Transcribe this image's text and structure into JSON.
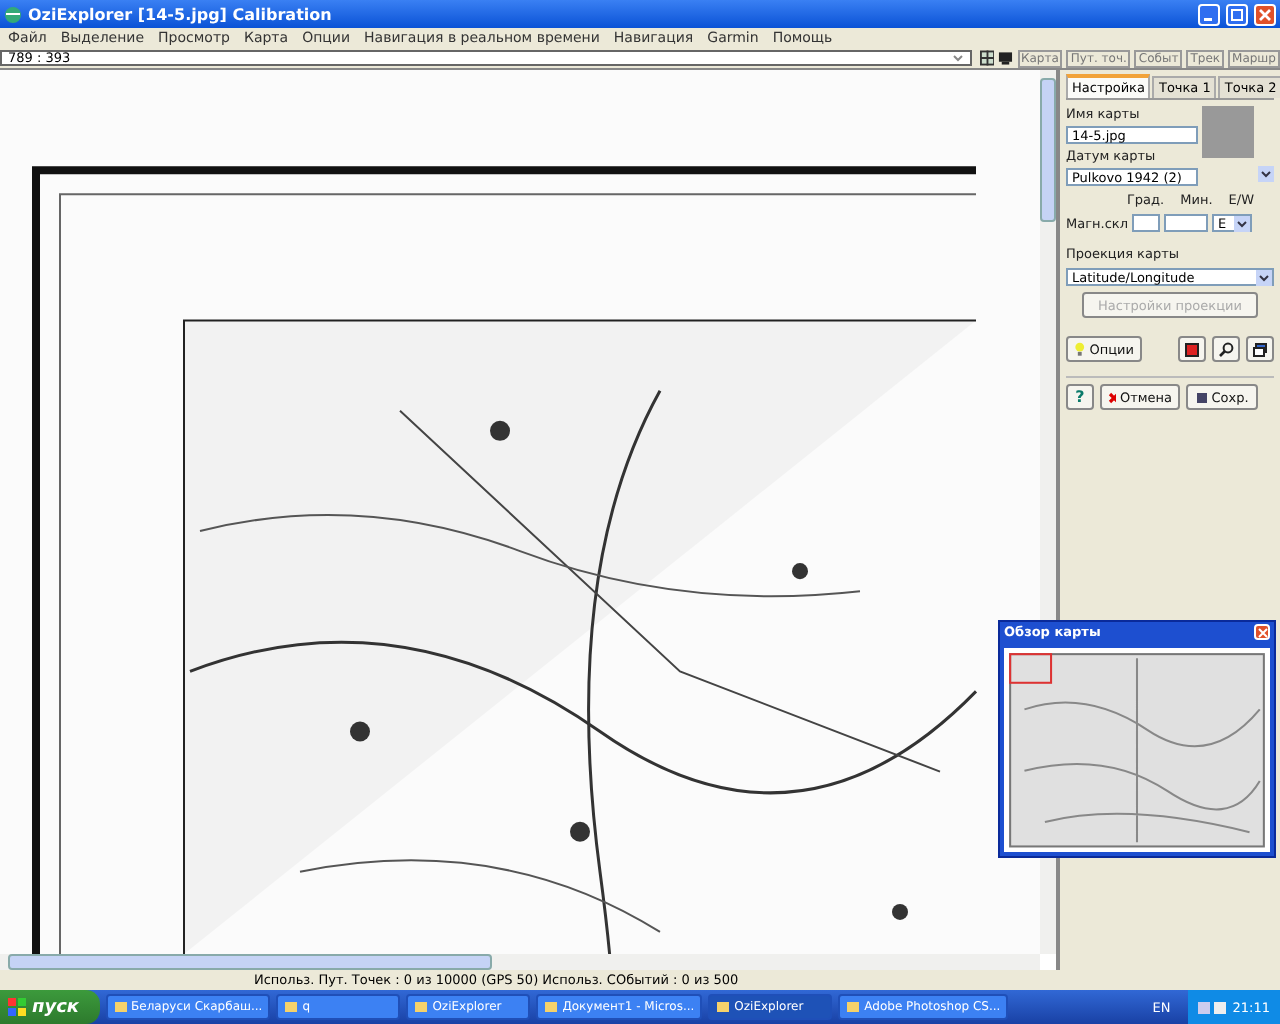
{
  "window": {
    "title": "OziExplorer [14-5.jpg] Calibration"
  },
  "menu": [
    "Файл",
    "Выделение",
    "Просмотр",
    "Карта",
    "Опции",
    "Навигация в реальном времени",
    "Навигация",
    "Garmin",
    "Помощь"
  ],
  "coordinates": "789 : 393",
  "view_buttons": [
    "Карта",
    "Пут. точ.",
    "Событ",
    "Трек",
    "Маршр"
  ],
  "panel": {
    "tabs": [
      {
        "label": "Настройка",
        "selected": true
      },
      {
        "label": "Точка 1",
        "selected": false
      },
      {
        "label": "Точка 2",
        "selected": false
      }
    ],
    "map_name_label": "Имя карты",
    "map_name": "14-5.jpg",
    "datum_label": "Датум карты",
    "datum": "Pulkovo 1942 (2)",
    "deg_label": "Град.",
    "min_label": "Мин.",
    "ew_label": "E/W",
    "magvar_label": "Магн.скл",
    "ew": "E",
    "projection_label": "Проекция карты",
    "projection": "Latitude/Longitude",
    "projection_settings": {
      "label": "Настройки проекции",
      "disabled": true
    },
    "options_button": "Опции",
    "help_button": "?",
    "cancel_button": "Отмена",
    "save_button": "Сохр."
  },
  "overview": {
    "title": "Обзор карты"
  },
  "status_bar": "Использ. Пут. Точек : 0 из 10000  (GPS 50)  Использ. СОбытий : 0 из 500",
  "taskbar": {
    "start": "пуск",
    "tasks": [
      {
        "label": "Беларуси Скарбаш...",
        "selected": false
      },
      {
        "label": "q",
        "selected": false
      },
      {
        "label": "OziExplorer",
        "selected": false
      },
      {
        "label": "Документ1 - Micros...",
        "selected": false
      },
      {
        "label": "OziExplorer",
        "selected": true
      },
      {
        "label": "Adobe Photoshop CS...",
        "selected": false
      }
    ],
    "lang": "EN",
    "clock": "21:11"
  }
}
